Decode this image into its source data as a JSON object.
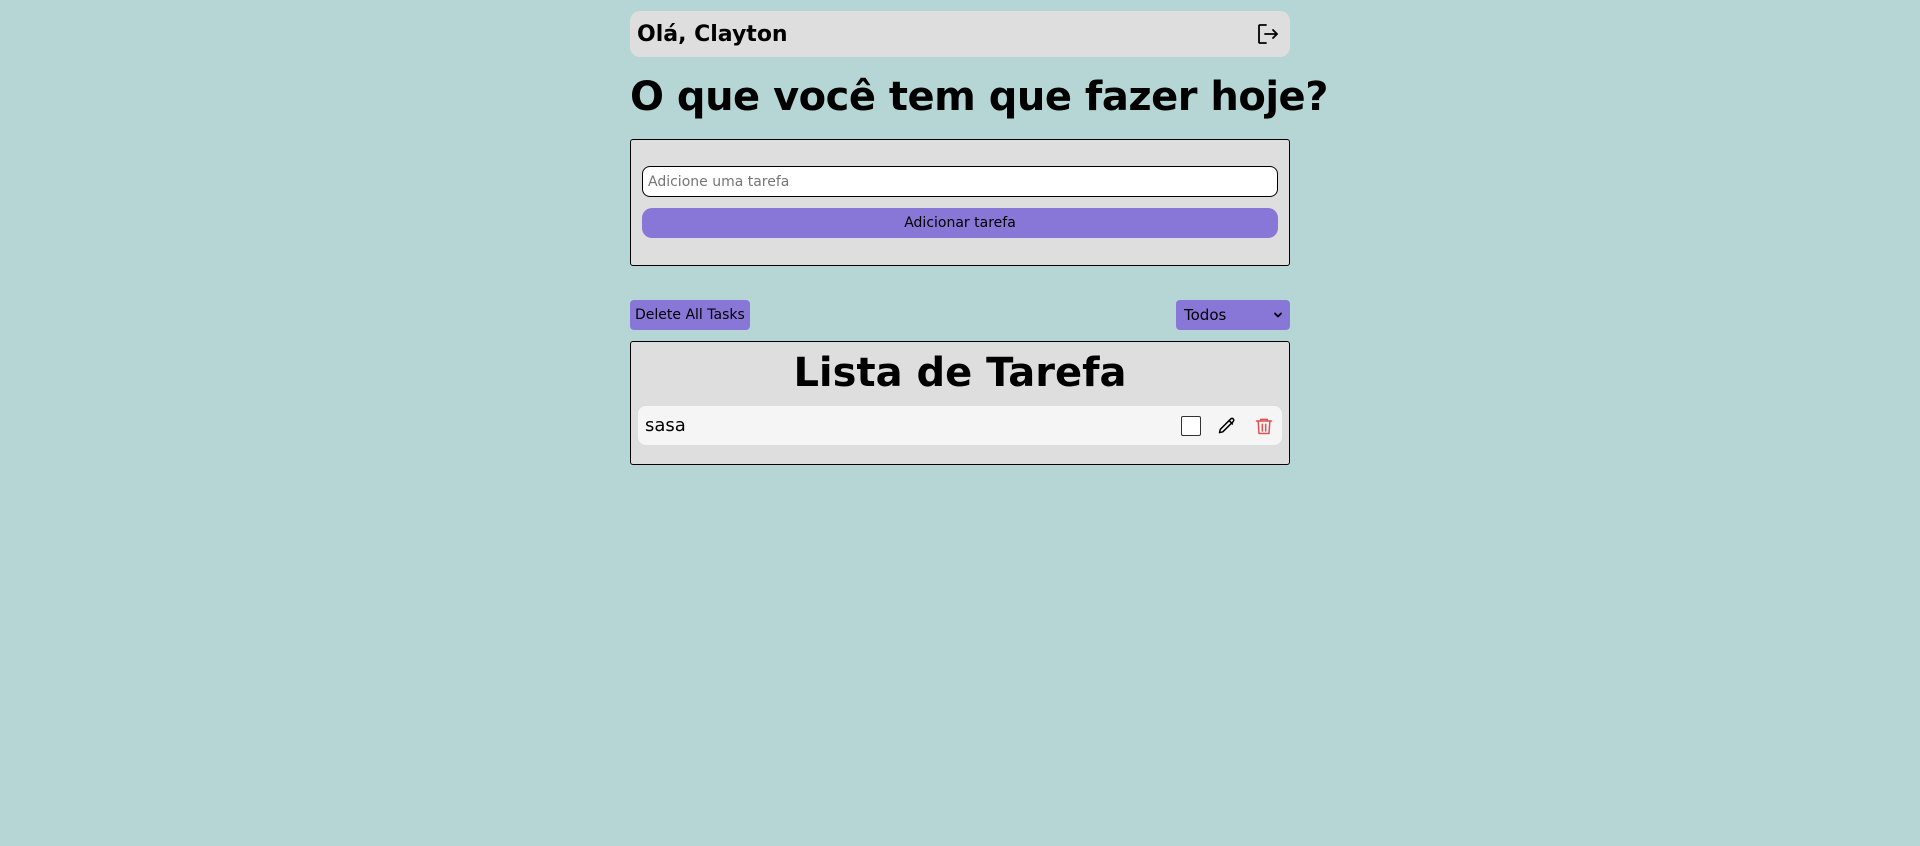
{
  "header": {
    "greeting": "Olá, Clayton",
    "logout_icon": "logout-icon"
  },
  "main": {
    "title": "O que você tem que fazer hoje?"
  },
  "form": {
    "placeholder": "Adicione uma tarefa",
    "value": "",
    "add_label": "Adicionar tarefa"
  },
  "controls": {
    "delete_all_label": "Delete All Tasks",
    "filter_selected": "Todos"
  },
  "list": {
    "title": "Lista de Tarefa",
    "tasks": [
      {
        "text": "sasa",
        "checked": false,
        "edit_icon": "pencil-icon",
        "delete_icon": "trash-icon"
      }
    ]
  },
  "colors": {
    "background": "#b5d6d5",
    "panel": "#dedede",
    "accent": "#8877d6",
    "task_row": "#f5f5f5",
    "delete": "#e05252"
  }
}
